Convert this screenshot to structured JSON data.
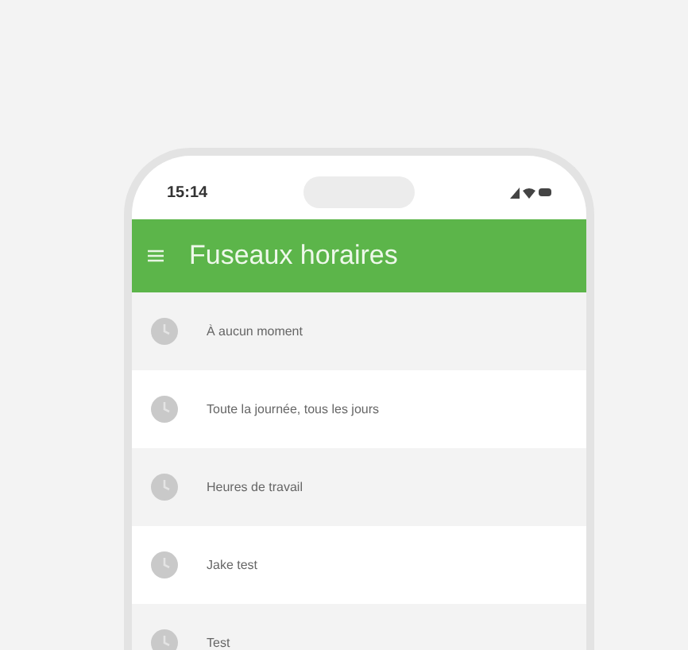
{
  "status_bar": {
    "time": "15:14"
  },
  "header": {
    "title": "Fuseaux horaires"
  },
  "items": [
    {
      "label": "À aucun moment"
    },
    {
      "label": "Toute la journée, tous les jours"
    },
    {
      "label": "Heures de travail"
    },
    {
      "label": "Jake test"
    },
    {
      "label": "Test"
    }
  ]
}
